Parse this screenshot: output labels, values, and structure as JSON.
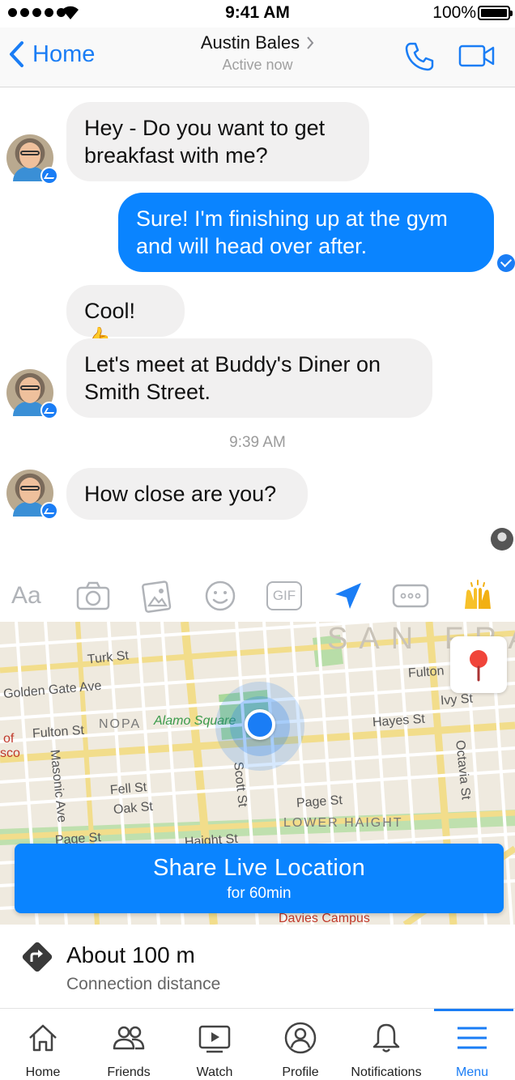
{
  "status_bar": {
    "time": "9:41 AM",
    "battery": "100%"
  },
  "header": {
    "back_label": "Home",
    "contact_name": "Austin Bales",
    "contact_status": "Active now"
  },
  "messages": [
    {
      "from": "contact",
      "text_lines": [
        "Hey - Do you want to get",
        "breakfast with me?"
      ]
    },
    {
      "from": "me",
      "text_lines": [
        "Sure! I'm finishing up at the gym",
        "and will head over after."
      ]
    },
    {
      "from": "contact",
      "text": "Cool! 👍"
    },
    {
      "from": "contact",
      "text_lines": [
        "Let's meet at Buddy's Diner on",
        "Smith Street."
      ]
    },
    {
      "from": "contact",
      "text": "How close are you?"
    }
  ],
  "timestamp": "9:39 AM",
  "composer": {
    "text_label": "Aa",
    "gif_label": "GIF",
    "tools": [
      "camera-icon",
      "gallery-icon",
      "emoji-icon",
      "gif-icon",
      "location-arrow-icon",
      "more-icon",
      "raised-hands-icon"
    ]
  },
  "map": {
    "labels": {
      "san": "SAN FRA",
      "turk": "Turk St",
      "golden_gate": "Golden Gate Ave",
      "fulton_right": "Fulton",
      "ivy": "Ivy St",
      "nopa": "NOPA",
      "alamo": "Alamo Square",
      "fulton_left": "Fulton St",
      "of": "of",
      "sco": "sco",
      "hayes": "Hayes St",
      "masonic": "Masonic Ave",
      "scott": "Scott St",
      "octavia": "Octavia St",
      "fell": "Fell St",
      "oak": "Oak St",
      "page_right": "Page St",
      "lower_haight": "LOWER HAIGHT",
      "page_left": "Page St",
      "haight": "Haight St",
      "davies": "Davies Campus"
    }
  },
  "share": {
    "title": "Share Live Location",
    "subtitle": "for 60min"
  },
  "distance": {
    "value": "About 100 m",
    "label": "Connection distance"
  },
  "tabs": [
    {
      "label": "Home",
      "icon": "home-icon"
    },
    {
      "label": "Friends",
      "icon": "friends-icon"
    },
    {
      "label": "Watch",
      "icon": "watch-icon"
    },
    {
      "label": "Profile",
      "icon": "profile-icon"
    },
    {
      "label": "Notifications",
      "icon": "bell-icon"
    },
    {
      "label": "Menu",
      "icon": "menu-icon",
      "active": true
    }
  ],
  "colors": {
    "accent": "#1a7df5",
    "bubble_out": "#0a84ff",
    "bubble_in": "#f1f0f0"
  }
}
